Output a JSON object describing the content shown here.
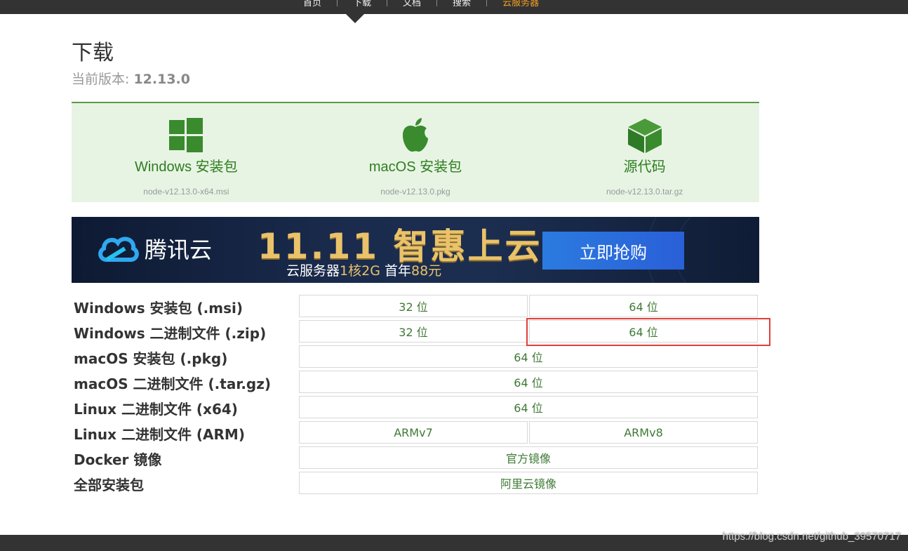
{
  "nav": {
    "items": [
      {
        "label": "首页",
        "active": false
      },
      {
        "label": "下载",
        "active": false
      },
      {
        "label": "文档",
        "active": false
      },
      {
        "label": "搜索",
        "active": false
      },
      {
        "label": "云服务器",
        "active": true
      }
    ]
  },
  "page": {
    "title": "下载",
    "version_label": "当前版本:",
    "version_value": "12.13.0"
  },
  "downloads": [
    {
      "icon": "windows-icon",
      "label": "Windows 安装包",
      "file": "node-v12.13.0-x64.msi"
    },
    {
      "icon": "apple-icon",
      "label": "macOS 安装包",
      "file": "node-v12.13.0.pkg"
    },
    {
      "icon": "box-icon",
      "label": "源代码",
      "file": "node-v12.13.0.tar.gz"
    }
  ],
  "banner": {
    "brand": "腾讯云",
    "headline": "11.11 智惠上云",
    "sub_prefix": "云服务器",
    "sub_highlight": "1核2G",
    "sub_middle": "首年",
    "sub_price": "88元",
    "cta": "立即抢购"
  },
  "table": [
    {
      "label": "Windows 安装包 (.msi)",
      "cells": [
        "32 位",
        "64 位"
      ]
    },
    {
      "label": "Windows 二进制文件 (.zip)",
      "cells": [
        "32 位",
        "64 位"
      ]
    },
    {
      "label": "macOS 安装包 (.pkg)",
      "cells": [
        "64 位"
      ]
    },
    {
      "label": "macOS 二进制文件 (.tar.gz)",
      "cells": [
        "64 位"
      ]
    },
    {
      "label": "Linux 二进制文件 (x64)",
      "cells": [
        "64 位"
      ]
    },
    {
      "label": "Linux 二进制文件 (ARM)",
      "cells": [
        "ARMv7",
        "ARMv8"
      ]
    },
    {
      "label": "Docker 镜像",
      "cells": [
        "官方镜像"
      ]
    },
    {
      "label": "全部安装包",
      "cells": [
        "阿里云镜像"
      ]
    }
  ],
  "watermark": "https://blog.csdn.net/github_39570717",
  "colors": {
    "accent_green": "#2e7d1f",
    "panel_bg": "#e7f4e4",
    "highlight_red": "#e0403a",
    "nav_active": "#f0a020"
  }
}
